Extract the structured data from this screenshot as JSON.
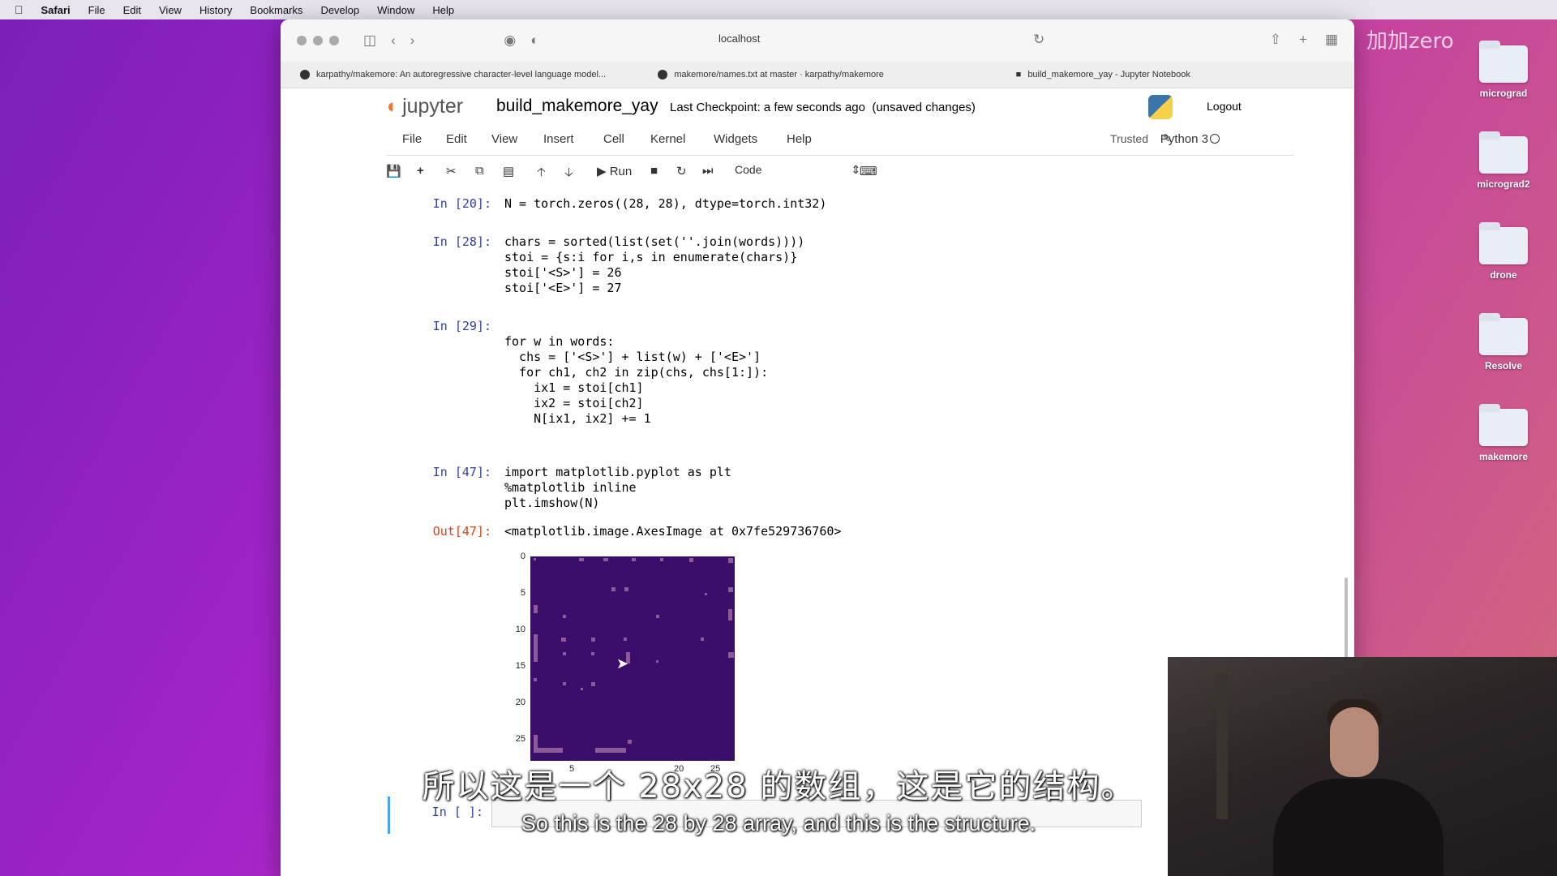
{
  "menubar": {
    "app": "Safari",
    "items": [
      "File",
      "Edit",
      "View",
      "History",
      "Bookmarks",
      "Develop",
      "Window",
      "Help"
    ]
  },
  "desktop": {
    "watermark": "加加zero",
    "icons": [
      {
        "label": "micrograd"
      },
      {
        "label": "micrograd2"
      },
      {
        "label": "drone"
      },
      {
        "label": "Resolve"
      },
      {
        "label": "makemore"
      }
    ]
  },
  "browser": {
    "url": "localhost",
    "tabs": [
      {
        "title": "karpathy/makemore: An autoregressive character-level language model..."
      },
      {
        "title": "makemore/names.txt at master · karpathy/makemore"
      },
      {
        "title": "build_makemore_yay - Jupyter Notebook"
      }
    ]
  },
  "jupyter": {
    "logo": "jupyter",
    "notebook_name": "build_makemore_yay",
    "checkpoint": "Last Checkpoint: a few seconds ago",
    "unsaved": "(unsaved changes)",
    "logout": "Logout",
    "menu": [
      "File",
      "Edit",
      "View",
      "Insert",
      "Cell",
      "Kernel",
      "Widgets",
      "Help"
    ],
    "trusted": "Trusted",
    "kernel": "Python 3",
    "run_label": "Run",
    "cell_type": "Code"
  },
  "cells": [
    {
      "prompt": "In [20]:",
      "code": "N = torch.zeros((28, 28), dtype=torch.int32)"
    },
    {
      "prompt": "In [28]:",
      "code": "chars = sorted(list(set(''.join(words))))\nstoi = {s:i for i,s in enumerate(chars)}\nstoi['<S>'] = 26\nstoi['<E>'] = 27"
    },
    {
      "prompt": "In [29]:",
      "code": "\nfor w in words:\n  chs = ['<S>'] + list(w) + ['<E>']\n  for ch1, ch2 in zip(chs, chs[1:]):\n    ix1 = stoi[ch1]\n    ix2 = stoi[ch2]\n    N[ix1, ix2] += 1"
    },
    {
      "prompt": "In [47]:",
      "code": "import matplotlib.pyplot as plt\n%matplotlib inline\nplt.imshow(N)"
    },
    {
      "prompt": "Out[47]:",
      "code": "<matplotlib.image.AxesImage at 0x7fe529736760>"
    },
    {
      "prompt": "In [ ]:",
      "code": ""
    }
  ],
  "plot": {
    "yticks": [
      "0",
      "5",
      "10",
      "15",
      "20",
      "25"
    ],
    "xticks": [
      "5",
      "20",
      "25"
    ]
  },
  "subtitles": {
    "zh": "所以这是一个 28x28 的数组，这是它的结构。",
    "en": "So this is the 28 by 28 array, and this is the structure."
  }
}
